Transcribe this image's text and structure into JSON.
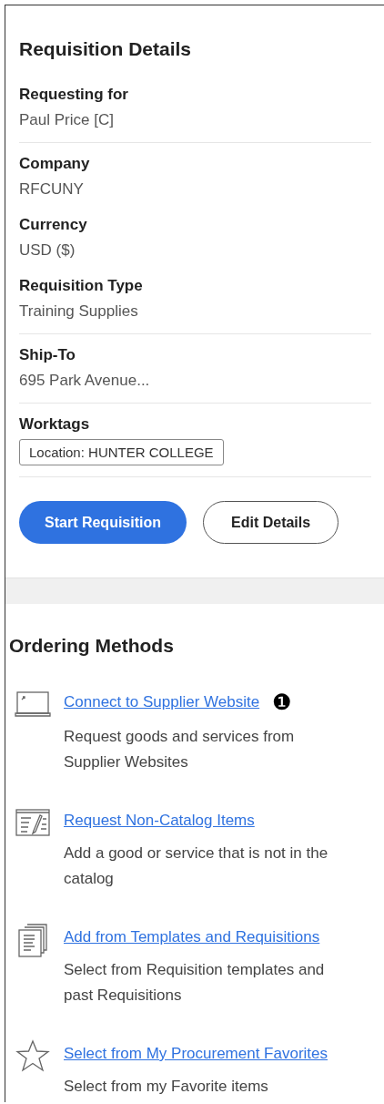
{
  "details": {
    "title": "Requisition Details",
    "fields": [
      {
        "label": "Requesting for",
        "value": "Paul Price [C]",
        "divider": true
      },
      {
        "label": "Company",
        "value": "RFCUNY",
        "divider": false
      },
      {
        "label": "Currency",
        "value": "USD ($)",
        "divider": false
      },
      {
        "label": "Requisition Type",
        "value": "Training Supplies",
        "divider": true
      },
      {
        "label": "Ship-To",
        "value": "695 Park Avenue...",
        "divider": true
      }
    ],
    "worktags": {
      "label": "Worktags",
      "tags": [
        "Location: HUNTER COLLEGE"
      ]
    },
    "buttons": [
      {
        "label": "Start Requisition",
        "kind": "primary"
      },
      {
        "label": "Edit Details",
        "kind": "secondary"
      }
    ]
  },
  "ordering_methods": {
    "title": "Ordering Methods",
    "methods": [
      {
        "kind": "laptop",
        "link": "Connect to Supplier Website",
        "badge": "❶",
        "description": "Request goods and services from Supplier Websites"
      },
      {
        "kind": "form",
        "link": "Request Non-Catalog Items",
        "description": "Add a good or service that is not in the catalog"
      },
      {
        "kind": "documents",
        "link": "Add from Templates and Requisitions",
        "description": "Select from Requisition templates and past Requisitions"
      },
      {
        "kind": "star",
        "link": "Select from My Procurement Favorites",
        "description": "Select from my Favorite items"
      }
    ]
  }
}
